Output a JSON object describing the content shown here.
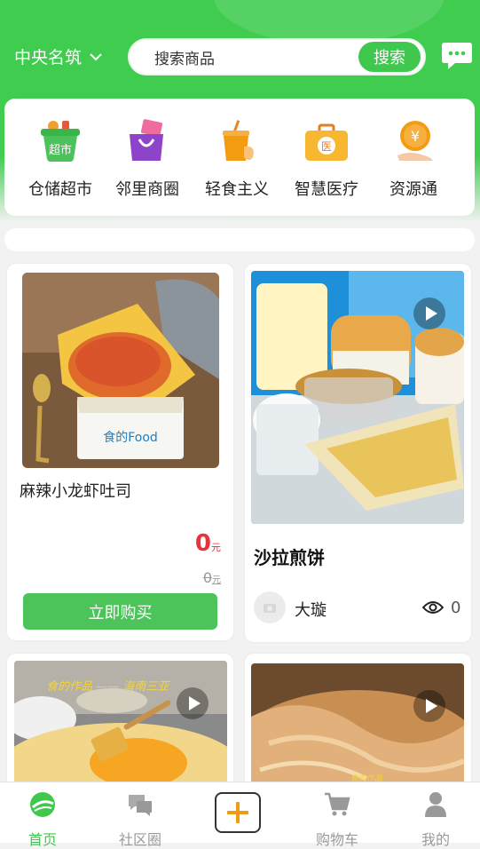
{
  "header": {
    "location": "中央名筑",
    "search_placeholder": "搜索商品",
    "search_button": "搜索"
  },
  "categories": [
    {
      "label": "仓储超市",
      "icon": "supermarket-basket-icon",
      "badge": "超市"
    },
    {
      "label": "邻里商圈",
      "icon": "shopping-bag-icon"
    },
    {
      "label": "轻食主义",
      "icon": "drink-cup-icon"
    },
    {
      "label": "智慧医疗",
      "icon": "medical-kit-icon",
      "badge": "医"
    },
    {
      "label": "资源通",
      "icon": "coin-hand-icon",
      "badge": "¥"
    }
  ],
  "products": [
    {
      "title": "麻辣小龙虾吐司",
      "price": "0",
      "price_unit": "元",
      "original_price": "0",
      "original_unit": "元",
      "buy_button": "立即购买"
    },
    {
      "title": "沙拉煎饼",
      "author": "大璇",
      "views": "0",
      "has_video": true
    },
    {
      "overlay_text": "食的作品 —— 海南三亚",
      "has_video": true
    },
    {
      "overlay_text": "食的作品",
      "has_video": true
    }
  ],
  "tabbar": {
    "items": [
      {
        "label": "首页",
        "icon": "home-icon",
        "active": true
      },
      {
        "label": "社区圈",
        "icon": "chat-bubbles-icon",
        "active": false
      },
      {
        "label": "购物车",
        "icon": "cart-icon",
        "active": false
      },
      {
        "label": "我的",
        "icon": "user-icon",
        "active": false
      }
    ]
  },
  "colors": {
    "brand_green": "#3fc74e",
    "price_red": "#e8323c"
  }
}
